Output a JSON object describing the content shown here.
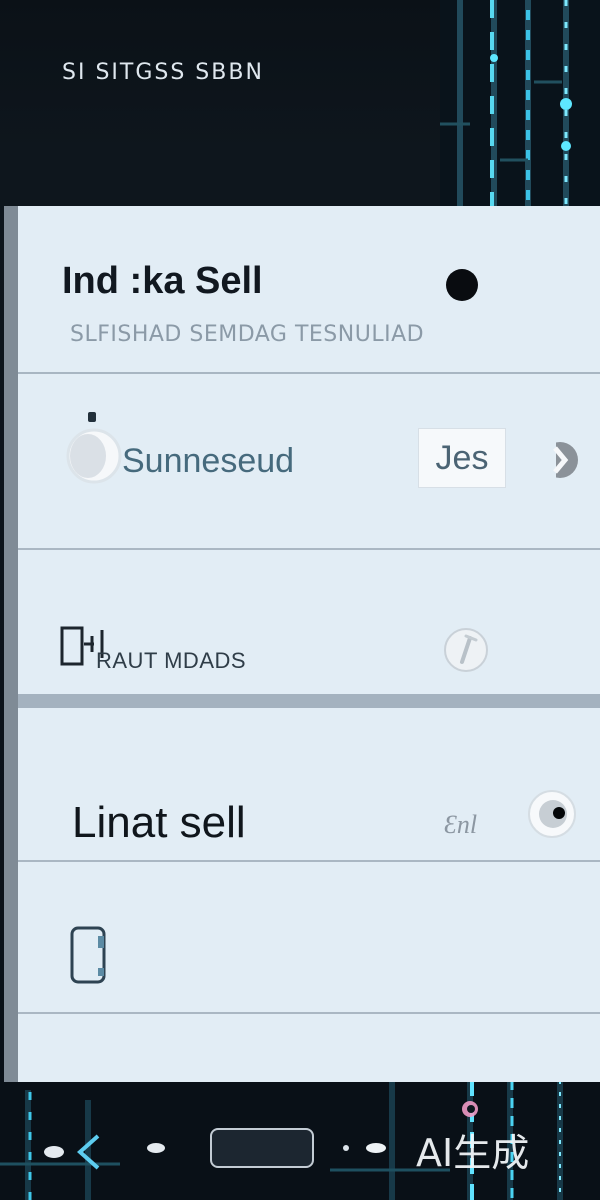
{
  "header": {
    "title": "SI SITGSS SBBN"
  },
  "hero": {
    "title": "Ind :ka Sell",
    "subtitle": "SLFISHAD SEMDAG TESNULIAD"
  },
  "rows": [
    {
      "label": "Sunneseud",
      "action_label": "Jes"
    },
    {
      "label": "RAUT MDADS"
    },
    {
      "label": "Linat sell",
      "muted": "Ɛnl"
    }
  ],
  "watermark": "AI生成"
}
